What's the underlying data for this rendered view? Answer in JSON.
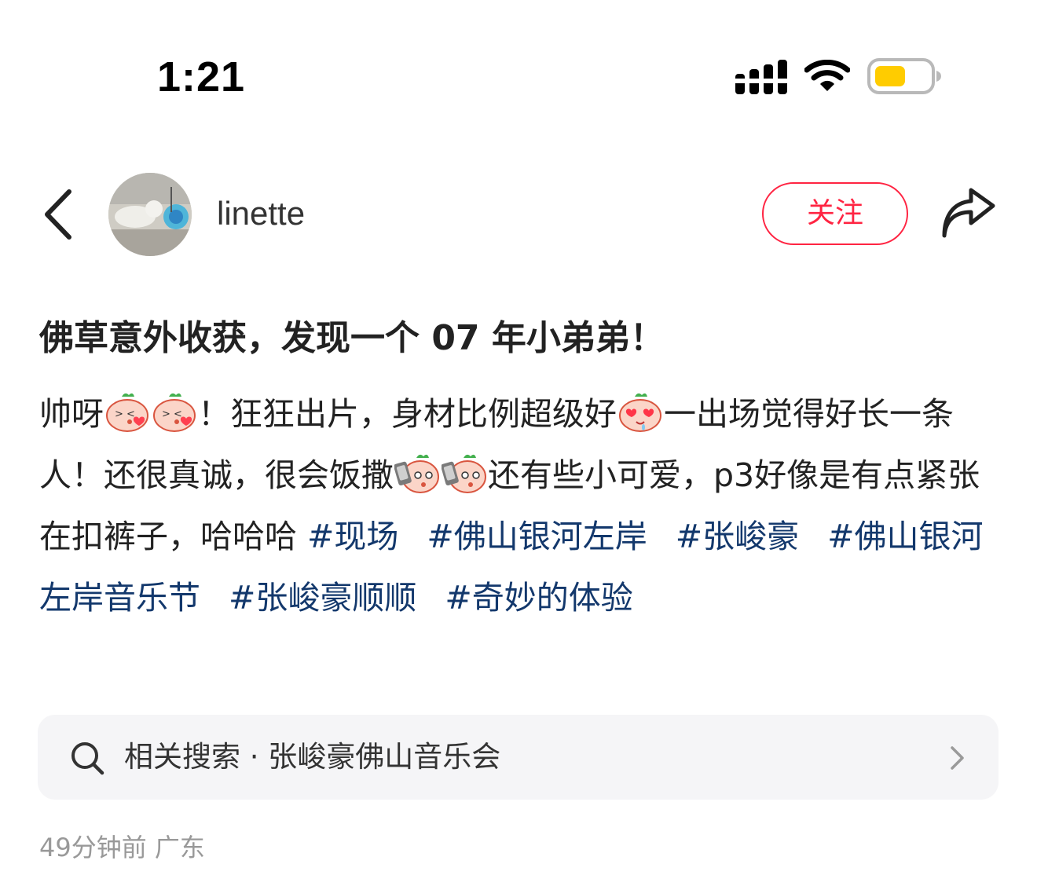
{
  "status_bar": {
    "time": "1:21"
  },
  "header": {
    "username": "linette",
    "follow_label": "关注"
  },
  "post": {
    "title": "佛草意外收获，发现一个 07 年小弟弟！",
    "body_segments": [
      "帅呀",
      "！狂狂出片，身材比例超级好",
      "一出场觉得好长一条人！还很真诚，很会饭撒",
      "还有些小可爱，p3好像是有点紧张在扣裤子，哈哈哈 "
    ],
    "hashtags": [
      "#现场",
      "#佛山银河左岸",
      "#张峻豪",
      "#佛山银河左岸音乐节",
      "#张峻豪顺顺",
      "#奇妙的体验"
    ]
  },
  "related_search": {
    "label": "相关搜索 · 张峻豪佛山音乐会"
  },
  "meta": {
    "time": "49分钟前",
    "location": "广东"
  },
  "colors": {
    "accent": "#ff2442",
    "hashtag": "#13386c",
    "battery": "#ffcc00",
    "muted": "#999999"
  },
  "icons": {
    "back": "chevron-left-icon",
    "share": "share-arrow-icon",
    "search": "search-icon",
    "chevron": "chevron-right-icon",
    "emoji_kiss": "kissing-peach-emoji",
    "emoji_heart_eyes": "heart-eyes-peach-emoji",
    "emoji_phone": "phone-selfie-peach-emoji"
  }
}
